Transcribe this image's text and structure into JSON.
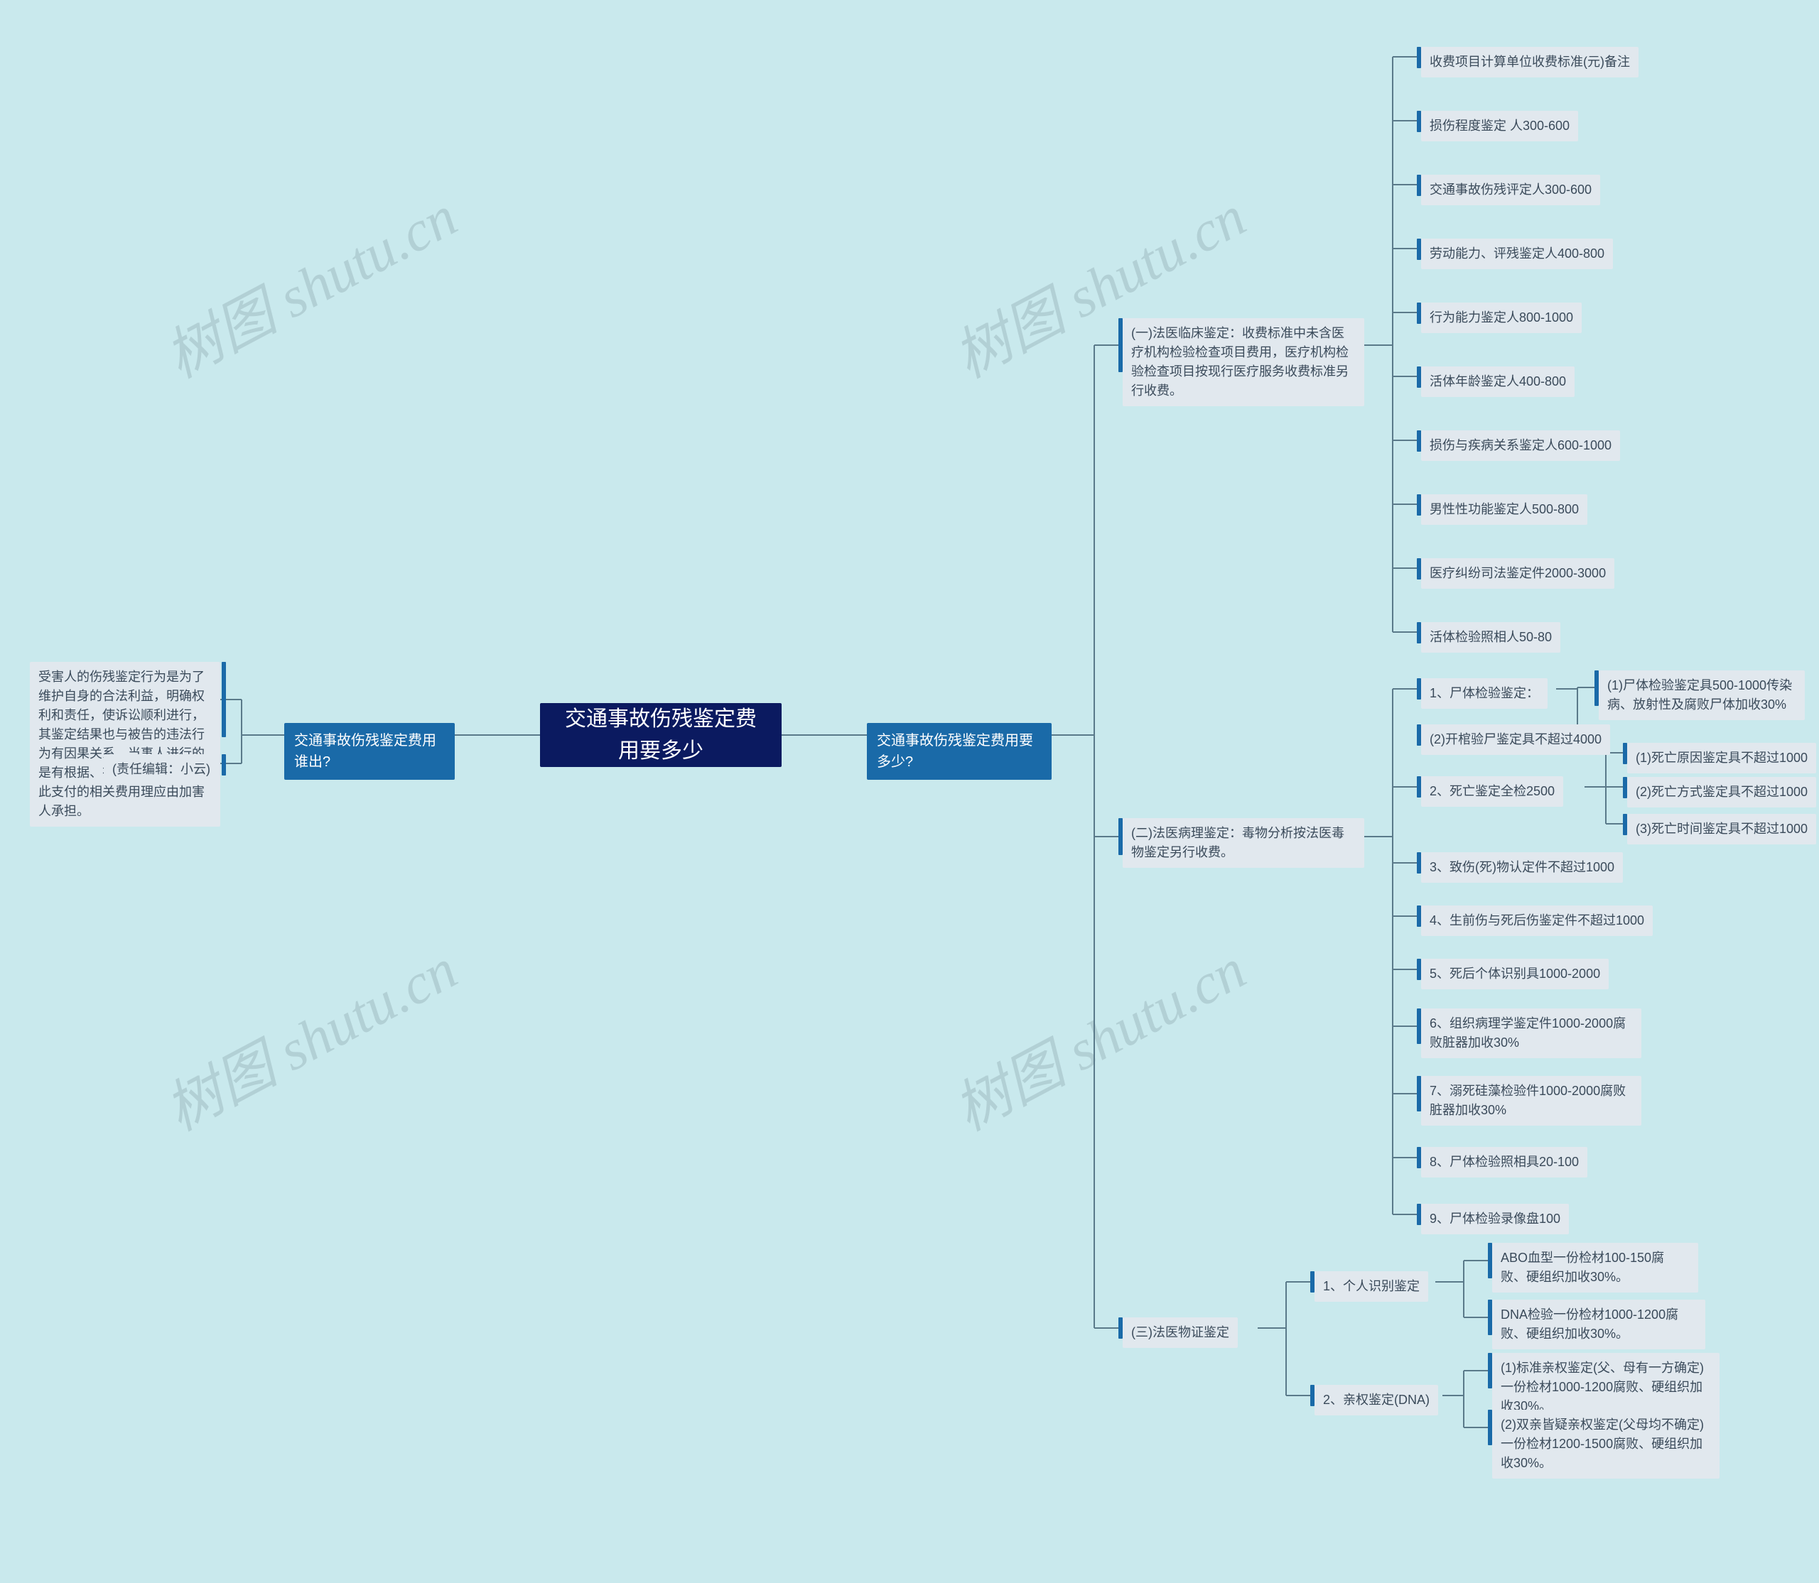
{
  "watermark": "树图 shutu.cn",
  "root": "交通事故伤残鉴定费用要多少",
  "branch_right": "交通事故伤残鉴定费用要多少?",
  "branch_left": "交通事故伤残鉴定费用谁出?",
  "left_info": "受害人的伤残鉴定行为是为了维护自身的合法利益，明确权利和责任，使诉讼顺利进行，其鉴定结果也与被告的违法行为有因果关系。当事人进行的是有根据、有必要的鉴定，由此支付的相关费用理应由加害人承担。",
  "left_editor": "(责任编辑：小云)",
  "cat1": {
    "title": "(一)法医临床鉴定：收费标准中未含医疗机构检验检查项目费用，医疗机构检验检查项目按现行医疗服务收费标准另行收费。",
    "items": [
      "收费项目计算单位收费标准(元)备注",
      "损伤程度鉴定 人300-600",
      "交通事故伤残评定人300-600",
      "劳动能力、评残鉴定人400-800",
      "行为能力鉴定人800-1000",
      "活体年龄鉴定人400-800",
      "损伤与疾病关系鉴定人600-1000",
      "男性性功能鉴定人500-800",
      "医疗纠纷司法鉴定件2000-3000",
      "活体检验照相人50-80"
    ]
  },
  "cat2": {
    "title": "(二)法医病理鉴定：毒物分析按法医毒物鉴定另行收费。",
    "n1": {
      "label": "1、尸体检验鉴定：",
      "sub": [
        "(1)尸体检验鉴定具500-1000传染病、放射性及腐败尸体加收30%",
        "(2)开棺验尸鉴定具不超过4000"
      ]
    },
    "n2": {
      "label": "2、死亡鉴定全检2500",
      "sub": [
        "(1)死亡原因鉴定具不超过1000",
        "(2)死亡方式鉴定具不超过1000",
        "(3)死亡时间鉴定具不超过1000"
      ]
    },
    "rest": [
      "3、致伤(死)物认定件不超过1000",
      "4、生前伤与死后伤鉴定件不超过1000",
      "5、死后个体识别具1000-2000",
      "6、组织病理学鉴定件1000-2000腐败脏器加收30%",
      "7、溺死硅藻检验件1000-2000腐败脏器加收30%",
      "8、尸体检验照相具20-100",
      "9、尸体检验录像盘100"
    ]
  },
  "cat3": {
    "title": "(三)法医物证鉴定",
    "n1": {
      "label": "1、个人识别鉴定",
      "sub": [
        "ABO血型一份检材100-150腐败、硬组织加收30%。",
        "DNA检验一份检材1000-1200腐败、硬组织加收30%。"
      ]
    },
    "n2": {
      "label": "2、亲权鉴定(DNA)",
      "sub": [
        "(1)标准亲权鉴定(父、母有一方确定)一份检材1000-1200腐败、硬组织加收30%。",
        "(2)双亲皆疑亲权鉴定(父母均不确定)一份检材1200-1500腐败、硬组织加收30%。"
      ]
    }
  },
  "icons": {
    "connector": "connector-line"
  }
}
